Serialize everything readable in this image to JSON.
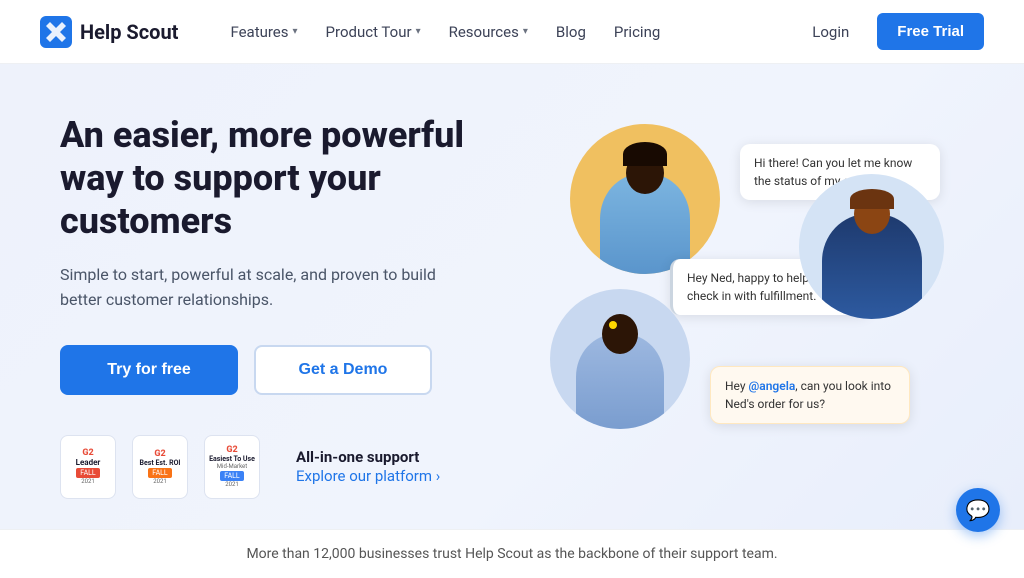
{
  "brand": {
    "name": "Help Scout",
    "logo_alt": "Help Scout logo"
  },
  "nav": {
    "links": [
      {
        "label": "Features",
        "has_dropdown": true
      },
      {
        "label": "Product Tour",
        "has_dropdown": true
      },
      {
        "label": "Resources",
        "has_dropdown": true
      },
      {
        "label": "Blog",
        "has_dropdown": false
      },
      {
        "label": "Pricing",
        "has_dropdown": false
      }
    ],
    "login_label": "Login",
    "cta_label": "Free Trial"
  },
  "hero": {
    "title": "An easier, more powerful way to support your customers",
    "subtitle": "Simple to start, powerful at scale, and proven to build better customer relationships.",
    "btn_primary": "Try for free",
    "btn_secondary": "Get a Demo",
    "badges": [
      {
        "id": "leader",
        "g2": "G2",
        "title": "Leader",
        "season": "FALL",
        "year": "2021",
        "color": "red"
      },
      {
        "id": "best-roi",
        "g2": "G2",
        "title": "Best Est. ROI",
        "season": "FALL",
        "year": "2021",
        "color": "orange"
      },
      {
        "id": "easiest",
        "g2": "G2",
        "title": "Easiest To Use",
        "season": "FALL",
        "year": "2021",
        "sub": "Mid-Market",
        "color": "blue"
      }
    ],
    "platform_label": "All-in-one support",
    "platform_link": "Explore our platform ›"
  },
  "chat": {
    "bubble1": "Hi there! Can you let me know the status of my order?",
    "bubble2": "Hey Ned, happy to help. Let me check in with fulfillment.",
    "bubble3_prefix": "Hey ",
    "bubble3_mention": "@angela",
    "bubble3_suffix": ", can you look into Ned's order for us?"
  },
  "footer": {
    "text": "More than 12,000 businesses trust Help Scout as the backbone of their support team."
  },
  "colors": {
    "primary": "#1f75e8",
    "background": "#eef2fb",
    "dark": "#1a1a2e"
  }
}
